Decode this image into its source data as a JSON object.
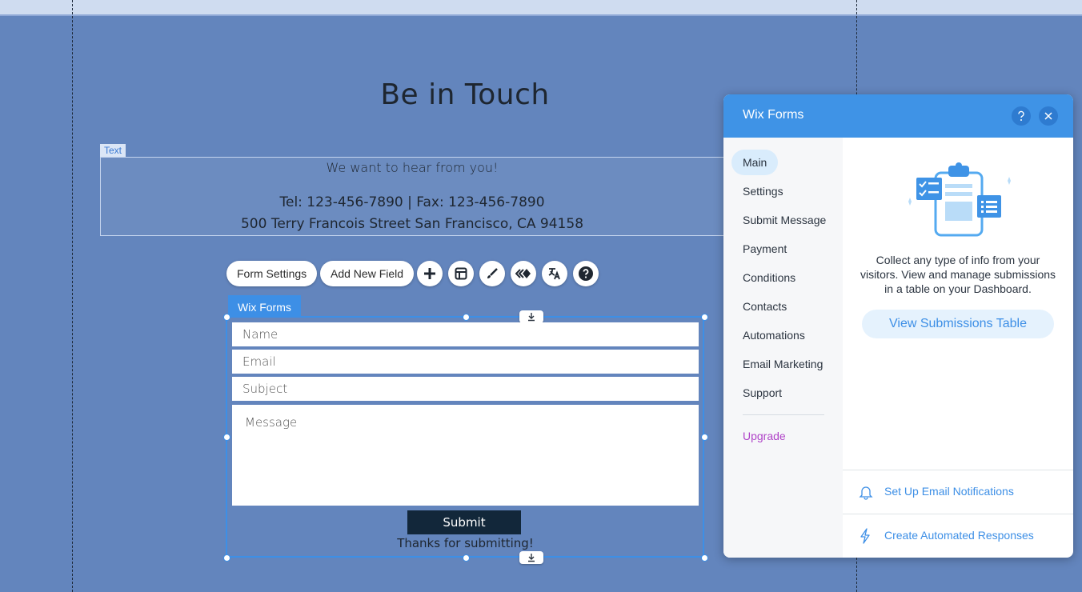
{
  "page": {
    "title": "Be in Touch",
    "text_tag": "Text",
    "text_lines": [
      "We want to hear from you!",
      "Tel: 123-456-7890 | Fax: 123-456-7890",
      "500 Terry Francois Street San Francisco, CA 94158"
    ]
  },
  "toolbar": {
    "form_settings": "Form Settings",
    "add_new_field": "Add New Field",
    "icons": [
      "plus-icon",
      "layout-icon",
      "brush-icon",
      "animation-icon",
      "translate-icon",
      "help-icon"
    ]
  },
  "form": {
    "tag": "Wix Forms",
    "fields": {
      "name": "Name",
      "email": "Email",
      "subject": "Subject",
      "message": "Message"
    },
    "submit": "Submit",
    "thanks": "Thanks for submitting!"
  },
  "panel": {
    "title": "Wix Forms",
    "nav": [
      "Main",
      "Settings",
      "Submit Message",
      "Payment",
      "Conditions",
      "Contacts",
      "Automations",
      "Email Marketing",
      "Support"
    ],
    "upgrade": "Upgrade",
    "description": "Collect any type of info from your visitors. View and manage submissions in a table on your Dashboard.",
    "view_button": "View Submissions Table",
    "email_notifications": "Set Up Email Notifications",
    "automated_responses": "Create Automated Responses"
  },
  "colors": {
    "canvas": "#6385bd",
    "accent": "#3d8fe6",
    "upgrade": "#b044c8"
  }
}
